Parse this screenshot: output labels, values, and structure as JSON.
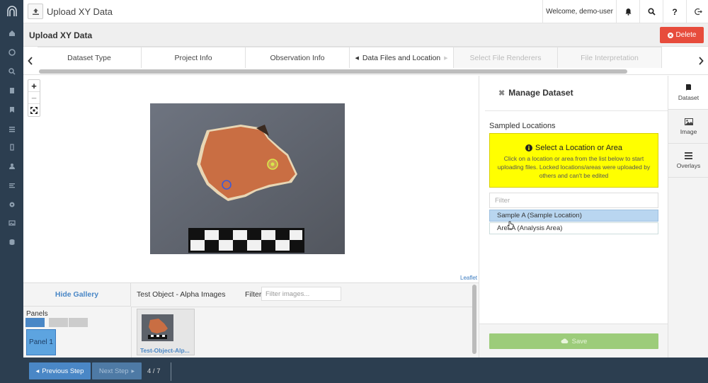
{
  "header": {
    "title": "Upload XY Data",
    "welcome": "Welcome, demo-user",
    "icons": [
      "bell-icon",
      "search-icon",
      "help-icon",
      "logout-icon"
    ]
  },
  "page": {
    "title": "Upload XY Data",
    "delete_label": "Delete"
  },
  "steps": {
    "tabs": [
      {
        "label": "Dataset Type",
        "state": "done"
      },
      {
        "label": "Project Info",
        "state": "done"
      },
      {
        "label": "Observation Info",
        "state": "done"
      },
      {
        "label": "Data Files and Location",
        "state": "active"
      },
      {
        "label": "Select File Renderers",
        "state": "disabled"
      },
      {
        "label": "File Interpretation",
        "state": "disabled"
      }
    ]
  },
  "map": {
    "zoom_in": "+",
    "zoom_out": "−",
    "attribution": "Leaflet"
  },
  "gallery": {
    "hide_label": "Hide Gallery",
    "panels_label": "Panels",
    "panel1_label": "Panel 1",
    "title": "Test Object - Alpha Images",
    "filter_label": "Filter",
    "filter_placeholder": "Filter images...",
    "thumb_label": "Test-Object-Alp..."
  },
  "manage": {
    "title": "Manage Dataset",
    "sampled_label": "Sampled Locations",
    "alert_title": "Select a Location or Area",
    "alert_body": "Click on a location or area from the list below to start uploading files. Locked locations/areas were uploaded by others and can't be edited",
    "filter_placeholder": "Filter",
    "locations": [
      {
        "label": "Sample A (Sample Location)",
        "selected": true
      },
      {
        "label": "AreaA (Analysis Area)",
        "selected": false
      }
    ],
    "save_label": "Save"
  },
  "right_tabs": [
    {
      "label": "Dataset",
      "icon": "book-icon"
    },
    {
      "label": "Image",
      "icon": "image-icon"
    },
    {
      "label": "Overlays",
      "icon": "layers-icon"
    }
  ],
  "footer": {
    "prev_label": "Previous Step",
    "next_label": "Next Step",
    "counter": "4 / 7"
  },
  "colors": {
    "sidebar": "#2c3e50",
    "accent": "#4a87c6",
    "delete": "#e74c3c",
    "alert": "#ffff00",
    "save": "#9ccc7a"
  }
}
